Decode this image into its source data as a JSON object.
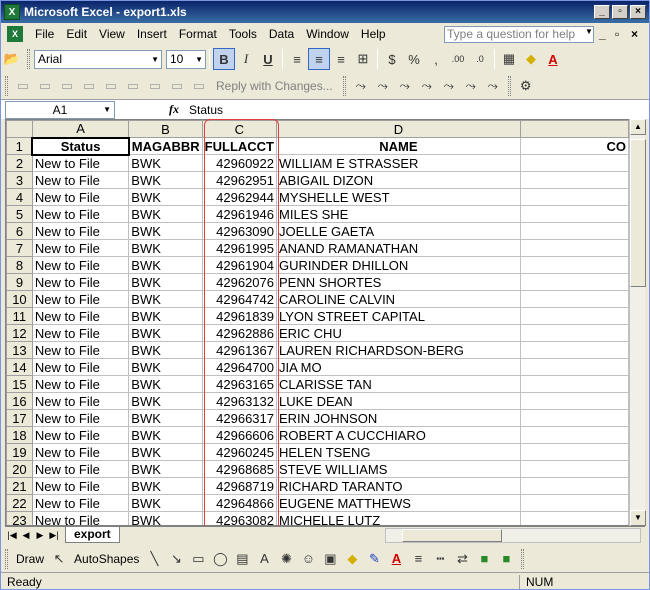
{
  "window": {
    "title": "Microsoft Excel - export1.xls"
  },
  "menu": [
    "File",
    "Edit",
    "View",
    "Insert",
    "Format",
    "Tools",
    "Data",
    "Window",
    "Help"
  ],
  "help_placeholder": "Type a question for help",
  "format_toolbar": {
    "font": "Arial",
    "size": "10",
    "bold": "B",
    "italic": "I",
    "underline": "U",
    "currency": "$",
    "percent": "%",
    "comma": ","
  },
  "review_toolbar": {
    "reply": "Reply with Changes..."
  },
  "formula_bar": {
    "cell": "A1",
    "fx": "fx",
    "value": "Status"
  },
  "columns": [
    "A",
    "B",
    "C",
    "D",
    ""
  ],
  "rows": [
    {
      "n": "1",
      "a": "Status",
      "b": "MAGABBR",
      "c": "FULLACCT",
      "d": "NAME",
      "e": "CO"
    },
    {
      "n": "2",
      "a": "New to File",
      "b": "BWK",
      "c": "42960922",
      "d": "WILLIAM E STRASSER",
      "e": ""
    },
    {
      "n": "3",
      "a": "New to File",
      "b": "BWK",
      "c": "42962951",
      "d": "ABIGAIL DIZON",
      "e": ""
    },
    {
      "n": "4",
      "a": "New to File",
      "b": "BWK",
      "c": "42962944",
      "d": "MYSHELLE WEST",
      "e": ""
    },
    {
      "n": "5",
      "a": "New to File",
      "b": "BWK",
      "c": "42961946",
      "d": "MILES SHE",
      "e": ""
    },
    {
      "n": "6",
      "a": "New to File",
      "b": "BWK",
      "c": "42963090",
      "d": "JOELLE GAETA",
      "e": ""
    },
    {
      "n": "7",
      "a": "New to File",
      "b": "BWK",
      "c": "42961995",
      "d": "ANAND RAMANATHAN",
      "e": ""
    },
    {
      "n": "8",
      "a": "New to File",
      "b": "BWK",
      "c": "42961904",
      "d": "GURINDER DHILLON",
      "e": ""
    },
    {
      "n": "9",
      "a": "New to File",
      "b": "BWK",
      "c": "42962076",
      "d": "PENN SHORTES",
      "e": ""
    },
    {
      "n": "10",
      "a": "New to File",
      "b": "BWK",
      "c": "42964742",
      "d": "CAROLINE CALVIN",
      "e": ""
    },
    {
      "n": "11",
      "a": "New to File",
      "b": "BWK",
      "c": "42961839",
      "d": "LYON STREET CAPITAL",
      "e": ""
    },
    {
      "n": "12",
      "a": "New to File",
      "b": "BWK",
      "c": "42962886",
      "d": "ERIC CHU",
      "e": ""
    },
    {
      "n": "13",
      "a": "New to File",
      "b": "BWK",
      "c": "42961367",
      "d": "LAUREN RICHARDSON-BERG",
      "e": ""
    },
    {
      "n": "14",
      "a": "New to File",
      "b": "BWK",
      "c": "42964700",
      "d": "JIA MO",
      "e": ""
    },
    {
      "n": "15",
      "a": "New to File",
      "b": "BWK",
      "c": "42963165",
      "d": "CLARISSE TAN",
      "e": ""
    },
    {
      "n": "16",
      "a": "New to File",
      "b": "BWK",
      "c": "42963132",
      "d": "LUKE DEAN",
      "e": ""
    },
    {
      "n": "17",
      "a": "New to File",
      "b": "BWK",
      "c": "42966317",
      "d": "ERIN JOHNSON",
      "e": ""
    },
    {
      "n": "18",
      "a": "New to File",
      "b": "BWK",
      "c": "42966606",
      "d": "ROBERT A CUCCHIARO",
      "e": ""
    },
    {
      "n": "19",
      "a": "New to File",
      "b": "BWK",
      "c": "42960245",
      "d": "HELEN TSENG",
      "e": ""
    },
    {
      "n": "20",
      "a": "New to File",
      "b": "BWK",
      "c": "42968685",
      "d": "STEVE WILLIAMS",
      "e": ""
    },
    {
      "n": "21",
      "a": "New to File",
      "b": "BWK",
      "c": "42968719",
      "d": "RICHARD TARANTO",
      "e": ""
    },
    {
      "n": "22",
      "a": "New to File",
      "b": "BWK",
      "c": "42964866",
      "d": "EUGENE MATTHEWS",
      "e": ""
    },
    {
      "n": "23",
      "a": "New to File",
      "b": "BWK",
      "c": "42963082",
      "d": "MICHELLE LUTZ",
      "e": ""
    }
  ],
  "sheet_tab": "export",
  "draw_toolbar": {
    "draw": "Draw",
    "autoshapes": "AutoShapes"
  },
  "status": {
    "ready": "Ready",
    "num": "NUM"
  },
  "colors": {
    "title_bar": "#0a246a",
    "selection_header": "#ffd58f",
    "highlight": "#e04040"
  }
}
